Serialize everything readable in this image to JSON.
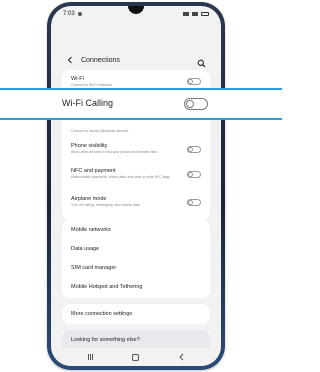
{
  "status_bar": {
    "time": "7:03"
  },
  "header": {
    "title": "Connections"
  },
  "rows": {
    "wifi": {
      "title": "Wi-Fi",
      "subtitle": "Connect to Wi-Fi networks.",
      "enabled": false
    },
    "bluetooth_sub": {
      "subtitle": "Connect to nearby Bluetooth devices."
    },
    "phone_visibility": {
      "title": "Phone visibility",
      "subtitle": "Allow other devices to find your phone and transfer files.",
      "enabled": false
    },
    "nfc": {
      "title": "NFC and payment",
      "subtitle": "Make mobile payments, share data, and read or write NFC tags.",
      "enabled": false
    },
    "airplane": {
      "title": "Airplane mode",
      "subtitle": "Turn off calling, messaging, and Mobile data.",
      "enabled": false
    }
  },
  "wifi_calling": {
    "title": "Wi-Fi Calling",
    "enabled": false
  },
  "menu": {
    "mobile_networks": "Mobile networks",
    "data_usage": "Data usage",
    "sim_card_manager": "SIM card manager",
    "hotspot": "Mobile Hotspot and Tethering"
  },
  "more_settings": "More connection settings",
  "looking_for": "Looking for something else?",
  "colors": {
    "highlight": "#2a9fd8",
    "background": "#f2f2f2"
  }
}
